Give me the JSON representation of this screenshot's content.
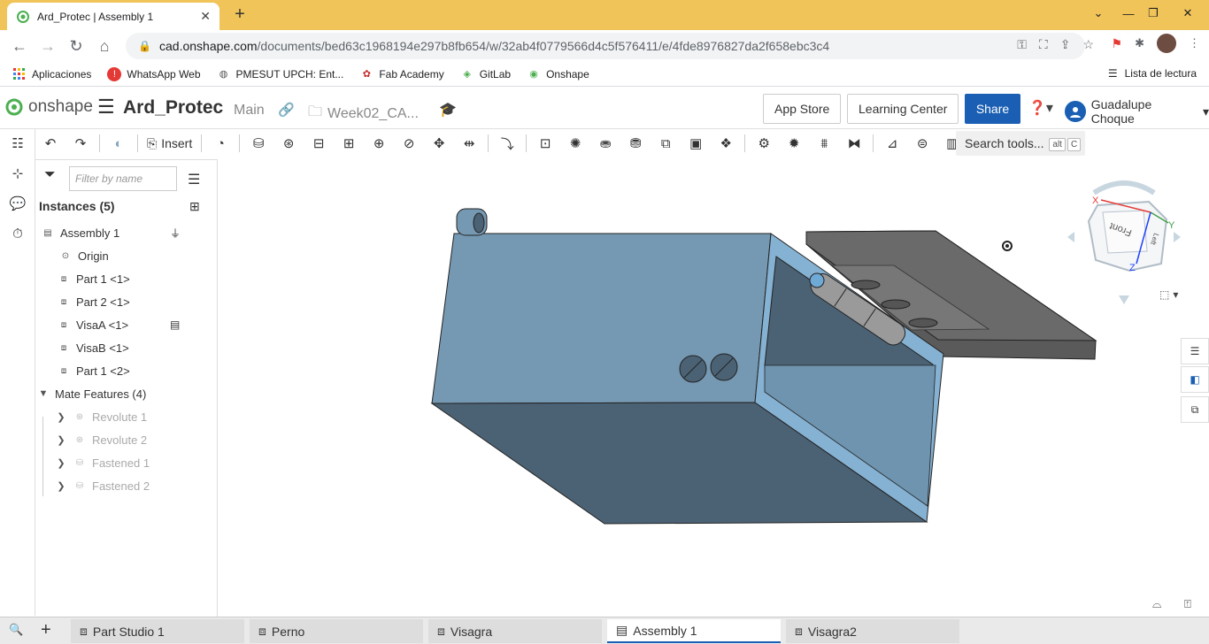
{
  "browser": {
    "tab_title": "Ard_Protec | Assembly 1",
    "url_host": "cad.onshape.com",
    "url_path": "/documents/bed63c1968194e297b8fb654/w/32ab4f0779566d4c5f576411/e/4fde8976827da2f658ebc3c4",
    "bookmarks": [
      "Aplicaciones",
      "WhatsApp Web",
      "PMESUT UPCH: Ent...",
      "Fab Academy",
      "GitLab",
      "Onshape"
    ],
    "reading_list": "Lista de lectura"
  },
  "header": {
    "brand": "onshape",
    "doc_name": "Ard_Protec",
    "branch": "Main",
    "folder": "Week02_CA...",
    "app_store": "App Store",
    "learning_center": "Learning Center",
    "share": "Share",
    "user": "Guadalupe Choque"
  },
  "toolbar": {
    "insert": "Insert",
    "search_tools": "Search tools...",
    "kbd1": "alt",
    "kbd2": "C"
  },
  "panel": {
    "filter_placeholder": "Filter by name",
    "instances_header": "Instances (5)",
    "assembly": "Assembly 1",
    "origin": "Origin",
    "instances": [
      "Part 1 <1>",
      "Part 2 <1>",
      "VisaA <1>",
      "VisaB <1>",
      "Part 1 <2>"
    ],
    "mates_header": "Mate Features (4)",
    "mates": [
      "Revolute 1",
      "Revolute 2",
      "Fastened 1",
      "Fastened 2"
    ]
  },
  "viewcube": {
    "front": "Front",
    "side": "Left",
    "x": "X",
    "y": "Y",
    "z": "Z"
  },
  "bottom_tabs": [
    "Part Studio 1",
    "Perno",
    "Visagra",
    "Assembly 1",
    "Visagra2"
  ],
  "colors": {
    "accent": "#1a5fb4",
    "chrome": "#f1c45a",
    "part_blue": "#7699b3",
    "part_dark": "#555555"
  }
}
